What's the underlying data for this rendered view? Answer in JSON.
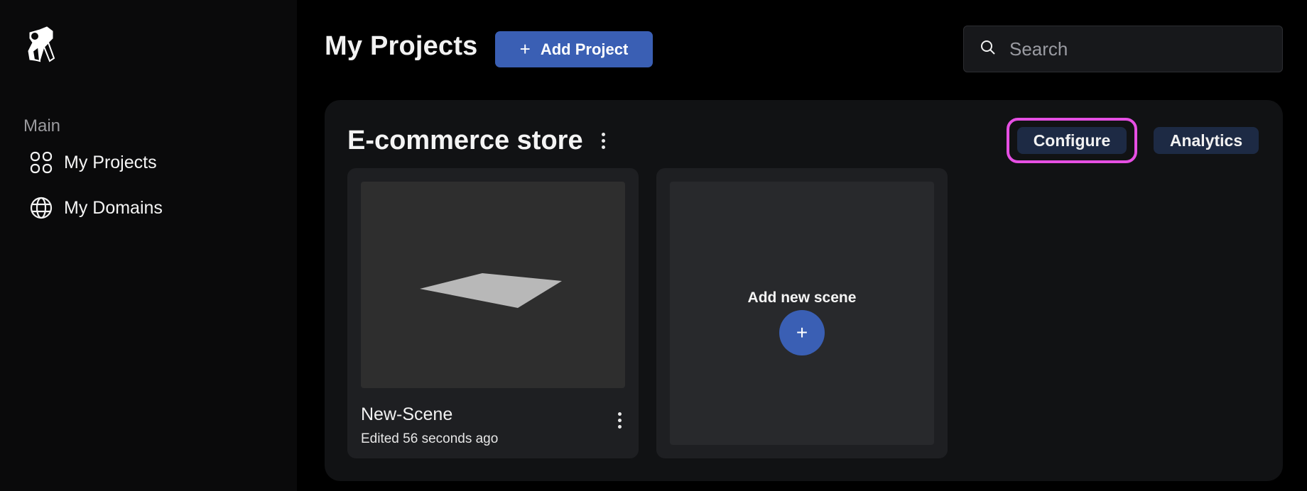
{
  "sidebar": {
    "logo": "app-logo",
    "section_label": "Main",
    "items": [
      {
        "label": "My Projects",
        "icon": "grid-icon"
      },
      {
        "label": "My Domains",
        "icon": "globe-icon"
      }
    ]
  },
  "header": {
    "title": "My Projects",
    "add_button": {
      "icon": "+",
      "label": "Add Project"
    },
    "search": {
      "placeholder": "Search",
      "value": ""
    }
  },
  "project": {
    "title": "E-commerce store",
    "actions": {
      "configure": "Configure",
      "analytics": "Analytics"
    },
    "scenes": [
      {
        "name": "New-Scene",
        "edited": "Edited 56 seconds ago"
      }
    ],
    "add_scene": {
      "label": "Add new scene",
      "icon": "+"
    }
  },
  "colors": {
    "accent": "#3a5fb4",
    "pill_bg": "#1d2a44",
    "highlight": "#e64fe3",
    "panel_bg": "#111214",
    "card_bg": "#1e1f22"
  }
}
